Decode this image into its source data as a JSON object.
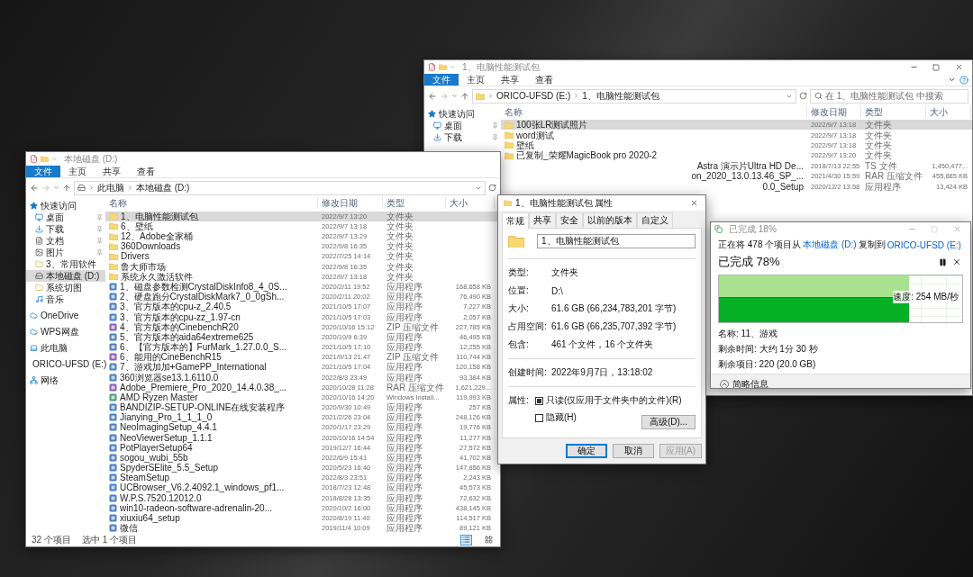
{
  "right_window": {
    "title": "1、电脑性能测试包",
    "ribbon_tabs": [
      {
        "label": "文件",
        "kind": "file"
      },
      {
        "label": "主页",
        "kind": "tab"
      },
      {
        "label": "共享",
        "kind": "tab"
      },
      {
        "label": "查看",
        "kind": "tab"
      }
    ],
    "path": [
      "ORICO-UFSD (E:)",
      "1、电脑性能测试包"
    ],
    "search": {
      "placeholder": "在 1、电脑性能测试包 中搜索"
    },
    "nav": [
      {
        "label": "快速访问",
        "kind": "star",
        "pinned": false,
        "selected": false,
        "children": [
          {
            "label": "桌面",
            "kind": "desktop",
            "pinned": true,
            "selected": false
          },
          {
            "label": "下载",
            "kind": "download",
            "pinned": true,
            "selected": false
          }
        ]
      }
    ],
    "columns": [
      "名称",
      "修改日期",
      "类型",
      "大小"
    ],
    "rows": [
      {
        "kind": "folder",
        "name": "100张LR测试照片",
        "date": "2022/9/7 13:18",
        "type": "文件夹",
        "selected": true
      },
      {
        "kind": "folder",
        "name": "word测试",
        "date": "2022/9/7 13:18",
        "type": "文件夹",
        "selected": false
      },
      {
        "kind": "folder",
        "name": "壁纸",
        "date": "2022/9/7 13:18",
        "type": "文件夹",
        "selected": false
      },
      {
        "kind": "folder",
        "name": "已复制_荣耀MagicBook pro 2020-2",
        "date": "2022/9/7 13:20",
        "type": "文件夹",
        "selected": false
      },
      {
        "kind": "cut",
        "name": "Astra 演示片Ultra HD De...",
        "date": "2018/7/13 22:55",
        "type": "TS 文件",
        "size": "1,450,477...",
        "selected": false
      },
      {
        "kind": "cut",
        "name": "on_2020_13.0.13.46_SP_...",
        "date": "2021/4/30 15:59",
        "type": "RAR 压缩文件",
        "size": "455,885 KB",
        "selected": false
      },
      {
        "kind": "cut",
        "name": "0.0_Setup",
        "date": "2020/12/2 13:58",
        "type": "应用程序",
        "size": "13,424 KB",
        "selected": false
      }
    ]
  },
  "left_window": {
    "title": "本地磁盘 (D:)",
    "ribbon_tabs": [
      {
        "label": "文件",
        "kind": "file"
      },
      {
        "label": "主页",
        "kind": "tab"
      },
      {
        "label": "共享",
        "kind": "tab"
      },
      {
        "label": "查看",
        "kind": "tab"
      }
    ],
    "path": [
      "此电脑",
      "本地磁盘 (D:)"
    ],
    "nav": [
      {
        "label": "快速访问",
        "kind": "star",
        "pinned": false,
        "selected": false,
        "children": [
          {
            "label": "桌面",
            "kind": "desktop",
            "pinned": true,
            "selected": false
          },
          {
            "label": "下载",
            "kind": "download",
            "pinned": true,
            "selected": false
          },
          {
            "label": "文档",
            "kind": "document",
            "pinned": true,
            "selected": false
          },
          {
            "label": "图片",
            "kind": "picture",
            "pinned": true,
            "selected": false
          },
          {
            "label": "3、常用软件",
            "kind": "folder",
            "pinned": false,
            "selected": false
          },
          {
            "label": "本地磁盘 (D:)",
            "kind": "drive",
            "pinned": false,
            "selected": true
          },
          {
            "label": "系统切图",
            "kind": "folder",
            "pinned": false,
            "selected": false
          },
          {
            "label": "音乐",
            "kind": "music",
            "pinned": false,
            "selected": false
          }
        ]
      },
      {
        "label": "OneDrive",
        "kind": "cloud",
        "pinned": false,
        "selected": false
      },
      {
        "label": "WPS网盘",
        "kind": "cloud",
        "pinned": false,
        "selected": false
      },
      {
        "label": "此电脑",
        "kind": "pc",
        "pinned": false,
        "selected": false
      },
      {
        "label": "ORICO-UFSD (E:)",
        "kind": "drive",
        "pinned": false,
        "selected": false
      },
      {
        "label": "网络",
        "kind": "network",
        "pinned": false,
        "selected": false
      }
    ],
    "columns": [
      "名称",
      "修改日期",
      "类型",
      "大小"
    ],
    "rows": [
      {
        "kind": "folder",
        "name": "1、电脑性能测试包",
        "date": "2022/9/7 13:20",
        "type": "文件夹",
        "selected": true
      },
      {
        "kind": "folder",
        "name": "6、壁纸",
        "date": "2022/9/7 13:18",
        "type": "文件夹",
        "selected": false
      },
      {
        "kind": "folder",
        "name": "12、Adobe全家桶",
        "date": "2022/9/7 13:29",
        "type": "文件夹",
        "selected": false
      },
      {
        "kind": "folder",
        "name": "360Downloads",
        "date": "2022/9/8 16:35",
        "type": "文件夹",
        "selected": false
      },
      {
        "kind": "folder",
        "name": "Drivers",
        "date": "2022/7/25 14:14",
        "type": "文件夹",
        "selected": false
      },
      {
        "kind": "folder",
        "name": "鲁大师市场",
        "date": "2022/9/8 16:35",
        "type": "文件夹",
        "selected": false
      },
      {
        "kind": "folder",
        "name": "系统永久激活软件",
        "date": "2022/9/7 13:18",
        "type": "文件夹",
        "selected": false
      },
      {
        "kind": "app",
        "name": "1、磁盘参数检测CrystalDiskInfo8_4_0S...",
        "date": "2020/2/11 19:52",
        "type": "应用程序",
        "size": "168,658 KB",
        "selected": false
      },
      {
        "kind": "app",
        "name": "2、硬盘跑分CrystalDiskMark7_0_0gSh...",
        "date": "2020/2/11 20:02",
        "type": "应用程序",
        "size": "76,490 KB",
        "selected": false
      },
      {
        "kind": "app",
        "name": "3、官方版本的cpu-z_2.40.5",
        "date": "2021/10/5 17:07",
        "type": "应用程序",
        "size": "7,227 KB",
        "selected": false
      },
      {
        "kind": "app",
        "name": "3、官方版本的cpu-zz_1.97-cn",
        "date": "2021/10/5 17:03",
        "type": "应用程序",
        "size": "2,057 KB",
        "selected": false
      },
      {
        "kind": "archive",
        "name": "4、官方版本的CinebenchR20",
        "date": "2020/10/16 15:12",
        "type": "ZIP 压缩文件",
        "size": "227,785 KB",
        "selected": false
      },
      {
        "kind": "app",
        "name": "5、官方版本的aida64extreme625",
        "date": "2020/10/9 6:39",
        "type": "应用程序",
        "size": "46,495 KB",
        "selected": false
      },
      {
        "kind": "app",
        "name": "6、【官方版本的】FurMark_1.27.0.0_S...",
        "date": "2021/10/5 17:10",
        "type": "应用程序",
        "size": "12,255 KB",
        "selected": false
      },
      {
        "kind": "archive",
        "name": "6、能用的CineBenchR15",
        "date": "2021/9/13 21:47",
        "type": "ZIP 压缩文件",
        "size": "110,744 KB",
        "selected": false
      },
      {
        "kind": "app",
        "name": "7、游戏加加+GamePP_International",
        "date": "2021/10/5 17:04",
        "type": "应用程序",
        "size": "120,158 KB",
        "selected": false
      },
      {
        "kind": "app",
        "name": "360浏览器se13.1.6110.0",
        "date": "2022/8/3 23:49",
        "type": "应用程序",
        "size": "93,384 KB",
        "selected": false
      },
      {
        "kind": "archive",
        "name": "Adobe_Premiere_Pro_2020_14.4.0.38_...",
        "date": "2020/10/28 11:28",
        "type": "RAR 压缩文件",
        "size": "1,621,229...",
        "selected": false
      },
      {
        "kind": "installer",
        "name": "AMD Ryzen Master",
        "date": "2020/10/16 14:20",
        "type": "Windows Install...",
        "size": "119,993 KB",
        "selected": false
      },
      {
        "kind": "app",
        "name": "BANDIZIP-SETUP-ONLINE在线安装程序",
        "date": "2020/9/30 10:49",
        "type": "应用程序",
        "size": "257 KB",
        "selected": false
      },
      {
        "kind": "app",
        "name": "Jianying_Pro_1_1_1_0",
        "date": "2021/2/26 23:04",
        "type": "应用程序",
        "size": "248,126 KB",
        "selected": false
      },
      {
        "kind": "app",
        "name": "NeoImagingSetup_4.4.1",
        "date": "2020/1/17 23:29",
        "type": "应用程序",
        "size": "19,776 KB",
        "selected": false
      },
      {
        "kind": "app",
        "name": "NeoViewerSetup_1.1.1",
        "date": "2020/10/16 14:54",
        "type": "应用程序",
        "size": "11,277 KB",
        "selected": false
      },
      {
        "kind": "app",
        "name": "PotPlayerSetup64",
        "date": "2019/12/7 16:44",
        "type": "应用程序",
        "size": "27,572 KB",
        "selected": false
      },
      {
        "kind": "app",
        "name": "sogou_wubi_55b",
        "date": "2022/6/9 15:41",
        "type": "应用程序",
        "size": "41,702 KB",
        "selected": false
      },
      {
        "kind": "app",
        "name": "SpyderSElite_5.5_Setup",
        "date": "2020/5/23 16:40",
        "type": "应用程序",
        "size": "147,856 KB",
        "selected": false
      },
      {
        "kind": "app",
        "name": "SteamSetup",
        "date": "2022/8/3 23:51",
        "type": "应用程序",
        "size": "2,243 KB",
        "selected": false
      },
      {
        "kind": "app",
        "name": "UCBrowser_V6.2.4092.1_windows_pf1...",
        "date": "2018/7/23 12:48",
        "type": "应用程序",
        "size": "45,573 KB",
        "selected": false
      },
      {
        "kind": "app",
        "name": "W.P.S.7520.12012.0",
        "date": "2018/8/28 13:35",
        "type": "应用程序",
        "size": "72,632 KB",
        "selected": false
      },
      {
        "kind": "app",
        "name": "win10-radeon-software-adrenalin-20...",
        "date": "2020/10/2 16:00",
        "type": "应用程序",
        "size": "438,145 KB",
        "selected": false
      },
      {
        "kind": "app",
        "name": "xiuxiu64_setup",
        "date": "2020/8/19 11:40",
        "type": "应用程序",
        "size": "114,517 KB",
        "selected": false
      },
      {
        "kind": "app",
        "name": "微信",
        "date": "2019/11/4 10:09",
        "type": "应用程序",
        "size": "89,121 KB",
        "selected": false
      }
    ],
    "status": {
      "count": "32 个项目",
      "selection": "选中 1 个项目"
    },
    "view_modes": [
      {
        "kind": "details",
        "selected": true
      },
      {
        "kind": "tiles",
        "selected": false
      }
    ]
  },
  "properties_dialog": {
    "title": "1、电脑性能测试包 属性",
    "tabs": [
      {
        "label": "常规",
        "selected": true
      },
      {
        "label": "共享",
        "selected": false
      },
      {
        "label": "安全",
        "selected": false
      },
      {
        "label": "以前的版本",
        "selected": false
      },
      {
        "label": "自定义",
        "selected": false
      }
    ],
    "name_value": "1、电脑性能测试包",
    "general": [
      {
        "label": "类型:",
        "value": "文件夹"
      },
      {
        "label": "位置:",
        "value": "D:\\"
      },
      {
        "label": "大小:",
        "value": "61.6 GB (66,234,783,201 字节)"
      },
      {
        "label": "占用空间:",
        "value": "61.6 GB (66,235,707,392 字节)"
      },
      {
        "label": "包含:",
        "value": "461 个文件，16 个文件夹"
      }
    ],
    "created": {
      "label": "创建时间:",
      "value": "2022年9月7日，13:18:02"
    },
    "attributes_label": "属性:",
    "checkboxes": [
      {
        "label": "只读(仅应用于文件夹中的文件)(R)",
        "checked": true
      },
      {
        "label": "隐藏(H)",
        "checked": false
      }
    ],
    "advanced_button": "高级(D)...",
    "buttons": [
      {
        "label": "确定",
        "kind": "default",
        "disabled": false
      },
      {
        "label": "取消",
        "kind": "normal",
        "disabled": false
      },
      {
        "label": "应用(A)",
        "kind": "normal",
        "disabled": true
      }
    ]
  },
  "copy_dialog": {
    "title": "已完成 18%",
    "from_text": "正在将 478 个项目从",
    "source": "本地磁盘 (D:)",
    "to_text": "复制到",
    "target": "ORICO-UFSD (E:)",
    "heading": "已完成 78%",
    "level": 0.78,
    "speed": "速度: 254 MB/秒",
    "details": [
      "名称: 11、游戏",
      "剩余时间: 大约 1分 30 秒",
      "剩余项目: 220 (20.0 GB)"
    ],
    "toggle": "简略信息"
  }
}
